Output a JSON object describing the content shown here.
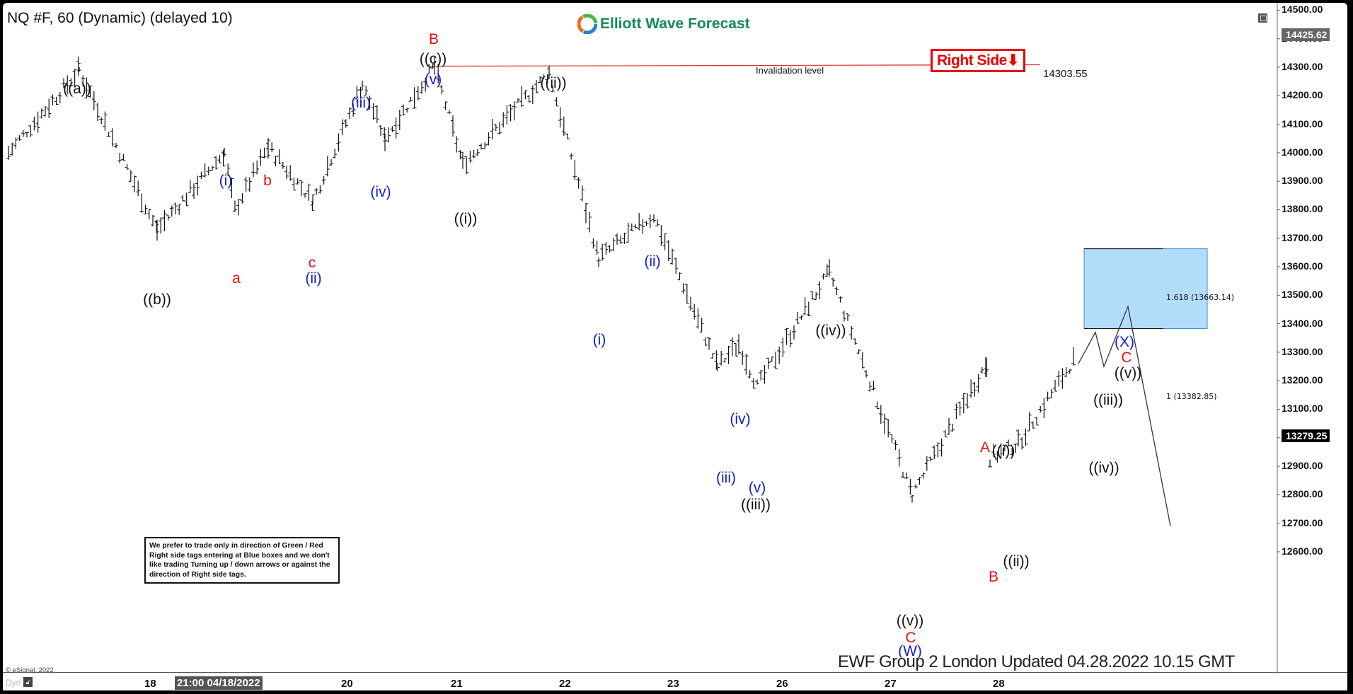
{
  "header": {
    "title": "NQ #F, 60 (Dynamic) (delayed 10)",
    "brand": "Elliott Wave Forecast"
  },
  "right_side_tag": {
    "label": "Right Side",
    "direction": "down",
    "color": "#e01010"
  },
  "invalidation": {
    "label": "Invalidation level",
    "price_label": "14303.55",
    "price": 14303.55
  },
  "fib_box": {
    "upper_label": "1.618 (13663.14)",
    "upper": 13663.14,
    "lower_label": "1 (13382.85)",
    "lower": 13382.85,
    "color": "#b3dcfa"
  },
  "note": "We prefer to trade only in direction of Green / Red Right side tags entering at Blue boxes and we don't like trading Turning up / down arrows or against the direction of Right side tags.",
  "copyright": "© eSignal, 2022",
  "footer": "EWF Group 2 London Updated 04.28.2022 10.15 GMT",
  "bottom": {
    "dyn": "Dyn",
    "crosshair_date": "21:00 04/18/2022"
  },
  "price_tags": {
    "crosshair": "14425.62",
    "last": "13279.25"
  },
  "chart_data": {
    "type": "ohlc",
    "title": "NQ #F, 60 (Dynamic) (delayed 10)",
    "ylim": [
      12600,
      14500
    ],
    "y_ticks": [
      "14500.00",
      "14400.00",
      "14300.00",
      "14200.00",
      "14100.00",
      "14000.00",
      "13900.00",
      "13800.00",
      "13700.00",
      "13600.00",
      "13500.00",
      "13400.00",
      "13300.00",
      "13200.00",
      "13100.00",
      "13000.00",
      "12900.00",
      "12800.00",
      "12700.00",
      "12600.00"
    ],
    "x_ticks": [
      "18",
      "20",
      "21",
      "22",
      "23",
      "26",
      "27",
      "28"
    ],
    "path_pivots": [
      {
        "label": "start",
        "price": 14000
      },
      {
        "label": "((a))",
        "price": 14290
      },
      {
        "label": "((b))",
        "price": 13730
      },
      {
        "label": "(i)",
        "price": 14000
      },
      {
        "label": "a",
        "price": 13800
      },
      {
        "label": "b",
        "price": 14020
      },
      {
        "label": "c / (ii)",
        "price": 13830
      },
      {
        "label": "(iii)",
        "price": 14240
      },
      {
        "label": "(iv)",
        "price": 14050
      },
      {
        "label": "B / ((c)) / (v)",
        "price": 14303.55
      },
      {
        "label": "((i))",
        "price": 13960
      },
      {
        "label": "((ii))",
        "price": 14280
      },
      {
        "label": "(i)",
        "price": 13630
      },
      {
        "label": "(ii)",
        "price": 13780
      },
      {
        "label": "(iii)",
        "price": 13250
      },
      {
        "label": "(iv)",
        "price": 13330
      },
      {
        "label": "(v) / ((iii))",
        "price": 13180
      },
      {
        "label": "((iv))",
        "price": 13580
      },
      {
        "label": "((v)) / C / (W)",
        "price": 12800
      },
      {
        "label": "A / ((i))",
        "price": 13260
      },
      {
        "label": "B",
        "price": 12930
      },
      {
        "label": "((ii))",
        "price": 12980
      },
      {
        "label": "last",
        "price": 13279.25
      }
    ],
    "projection": [
      {
        "label": "((iii))",
        "price": 13370
      },
      {
        "label": "((iv))",
        "price": 13250
      },
      {
        "label": "((v)) / C / (X)",
        "price": 13460
      },
      {
        "label": "target",
        "price": 12690
      }
    ],
    "wave_labels": [
      {
        "text": "((a))",
        "color": "black"
      },
      {
        "text": "((b))",
        "color": "black"
      },
      {
        "text": "(i)",
        "color": "blue"
      },
      {
        "text": "a",
        "color": "red"
      },
      {
        "text": "b",
        "color": "red"
      },
      {
        "text": "c",
        "color": "red"
      },
      {
        "text": "(ii)",
        "color": "blue"
      },
      {
        "text": "(iii)",
        "color": "blue"
      },
      {
        "text": "(iv)",
        "color": "blue"
      },
      {
        "text": "B",
        "color": "red"
      },
      {
        "text": "((c))",
        "color": "black"
      },
      {
        "text": "(v)",
        "color": "blue"
      },
      {
        "text": "((i))",
        "color": "black"
      },
      {
        "text": "((ii))",
        "color": "black"
      },
      {
        "text": "(i)",
        "color": "blue"
      },
      {
        "text": "(ii)",
        "color": "blue"
      },
      {
        "text": "(iii)",
        "color": "blue"
      },
      {
        "text": "(iv)",
        "color": "blue"
      },
      {
        "text": "(v)",
        "color": "blue"
      },
      {
        "text": "((iii))",
        "color": "black"
      },
      {
        "text": "((iv))",
        "color": "black"
      },
      {
        "text": "((v))",
        "color": "black"
      },
      {
        "text": "C",
        "color": "red"
      },
      {
        "text": "(W)",
        "color": "blue"
      },
      {
        "text": "A",
        "color": "red"
      },
      {
        "text": "((i))",
        "color": "black"
      },
      {
        "text": "B",
        "color": "red"
      },
      {
        "text": "((ii))",
        "color": "black"
      },
      {
        "text": "((iii))",
        "color": "black"
      },
      {
        "text": "((iv))",
        "color": "black"
      },
      {
        "text": "(X)",
        "color": "blue"
      },
      {
        "text": "C",
        "color": "red"
      },
      {
        "text": "((v))",
        "color": "black"
      }
    ]
  }
}
